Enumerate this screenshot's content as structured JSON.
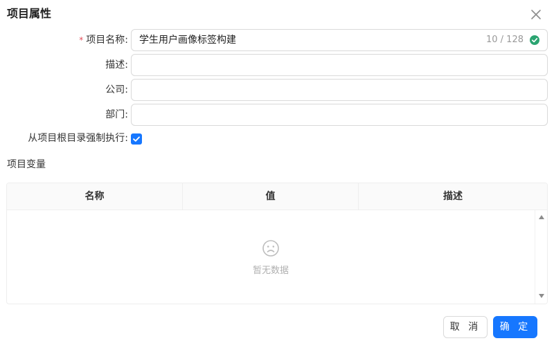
{
  "dialog": {
    "title": "项目属性",
    "close_icon": "close-icon"
  },
  "form": {
    "name": {
      "required_mark": "*",
      "label": "项目名称:",
      "value": "学生用户画像标签构建",
      "count": "10 / 128",
      "status_icon": "check-circle-icon",
      "status_color": "#2ba471"
    },
    "description": {
      "label": "描述:",
      "value": ""
    },
    "company": {
      "label": "公司:",
      "value": ""
    },
    "department": {
      "label": "部门:",
      "value": ""
    },
    "force_exec": {
      "label": "从项目根目录强制执行:",
      "checked": true
    }
  },
  "variables": {
    "section_title": "项目变量",
    "columns": [
      "名称",
      "值",
      "描述"
    ],
    "rows": [],
    "empty_icon": "frown-face-icon",
    "empty_text": "暂无数据"
  },
  "footer": {
    "cancel_label": "取 消",
    "ok_label": "确 定"
  },
  "colors": {
    "primary": "#1677ff",
    "required": "#e34d59",
    "success": "#2ba471"
  }
}
